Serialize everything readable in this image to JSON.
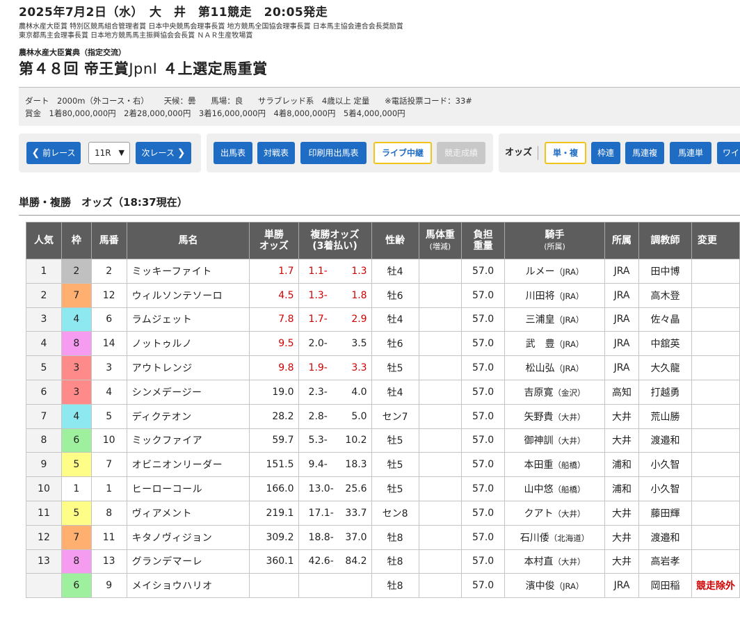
{
  "header": {
    "date_line": "2025年7月2日（水）　大　井　第11競走　20:05発走",
    "awards_line1": "農林水産大臣賞 特別区競馬組合管理者賞 日本中央競馬会理事長賞 地方競馬全国協会理事長賞 日本馬主協会連合会長奨励賞",
    "awards_line2": "東京都馬主会理事長賞 日本地方競馬馬主振興協会会長賞 ＮＡＲ生産牧場賞",
    "subtitle": "農林水産大臣賞典（指定交流）",
    "race_title_main": "第４８回 帝王賞",
    "race_title_grade": "JpnⅠ",
    "race_title_tail": "４上選定馬重賞"
  },
  "conditions": {
    "course": "ダート　2000m（外コース・右）",
    "weather": "天候：曇",
    "track": "馬場：良",
    "class": "サラブレッド系　4歳以上 定量",
    "phone_code": "※電話投票コード：33#",
    "prize": "賞金　1着80,000,000円　2着28,000,000円　3着16,000,000円　4着8,000,000円　5着4,000,000円"
  },
  "nav": {
    "prev_race": "前レース",
    "race_select_value": "11R",
    "next_race": "次レース",
    "entries": "出馬表",
    "matchup": "対戦表",
    "print_entries": "印刷用出馬表",
    "live": "ライブ中継",
    "results": "競走成績",
    "odds_label": "オッズ",
    "tansho_fukusho": "単・複",
    "wakuren": "枠連",
    "umaren_fuku": "馬連複",
    "umaren_tan": "馬連単",
    "wide": "ワイド"
  },
  "section_title": "単勝・複勝　オッズ（18:37現在）",
  "table": {
    "headers": {
      "ninki": "人気",
      "waku": "枠",
      "umaban": "馬番",
      "name": "馬名",
      "tansho_1": "単勝",
      "tansho_2": "オッズ",
      "fukusho_1": "複勝オッズ",
      "fukusho_2": "(3着払い)",
      "sexage": "性齢",
      "weight_1": "馬体重",
      "weight_2": "(増減)",
      "futan_1": "負担",
      "futan_2": "重量",
      "jockey_1": "騎手",
      "jockey_2": "(所属)",
      "shozoku": "所属",
      "trainer": "調教師",
      "change": "変更"
    },
    "waku_colors": {
      "1": "#ffffff",
      "2": "#c0c0c0",
      "3": "#ff8a8a",
      "4": "#8ee8f0",
      "5": "#fdfd88",
      "6": "#9ef09e",
      "7": "#ffb070",
      "8": "#f59cf0"
    },
    "rows": [
      {
        "ninki": "1",
        "waku": "2",
        "umaban": "2",
        "name": "ミッキーファイト",
        "tansho": "1.7",
        "fuku_lo": "1.1-",
        "fuku_hi": "1.3",
        "red": true,
        "sexage": "牡4",
        "weight": "",
        "futan": "57.0",
        "jockey": "ルメー",
        "jaff": "（JRA）",
        "shozoku": "JRA",
        "trainer": "田中博",
        "change": ""
      },
      {
        "ninki": "2",
        "waku": "7",
        "umaban": "12",
        "name": "ウィルソンテソーロ",
        "tansho": "4.5",
        "fuku_lo": "1.3-",
        "fuku_hi": "1.8",
        "red": true,
        "sexage": "牡6",
        "weight": "",
        "futan": "57.0",
        "jockey": "川田将",
        "jaff": "（JRA）",
        "shozoku": "JRA",
        "trainer": "高木登",
        "change": ""
      },
      {
        "ninki": "3",
        "waku": "4",
        "umaban": "6",
        "name": "ラムジェット",
        "tansho": "7.8",
        "fuku_lo": "1.7-",
        "fuku_hi": "2.9",
        "red": true,
        "sexage": "牡4",
        "weight": "",
        "futan": "57.0",
        "jockey": "三浦皇",
        "jaff": "（JRA）",
        "shozoku": "JRA",
        "trainer": "佐々晶",
        "change": ""
      },
      {
        "ninki": "4",
        "waku": "8",
        "umaban": "14",
        "name": "ノットゥルノ",
        "tansho": "9.5",
        "fuku_lo": "2.0-",
        "fuku_hi": "3.5",
        "red": "tansho",
        "sexage": "牡6",
        "weight": "",
        "futan": "57.0",
        "jockey": "武　豊",
        "jaff": "（JRA）",
        "shozoku": "JRA",
        "trainer": "中舘英",
        "change": ""
      },
      {
        "ninki": "5",
        "waku": "3",
        "umaban": "3",
        "name": "アウトレンジ",
        "tansho": "9.8",
        "fuku_lo": "1.9-",
        "fuku_hi": "3.3",
        "red": true,
        "sexage": "牡5",
        "weight": "",
        "futan": "57.0",
        "jockey": "松山弘",
        "jaff": "（JRA）",
        "shozoku": "JRA",
        "trainer": "大久龍",
        "change": ""
      },
      {
        "ninki": "6",
        "waku": "3",
        "umaban": "4",
        "name": "シンメデージー",
        "tansho": "19.0",
        "fuku_lo": "2.3-",
        "fuku_hi": "4.0",
        "red": false,
        "sexage": "牡4",
        "weight": "",
        "futan": "57.0",
        "jockey": "吉原寛",
        "jaff": "（金沢）",
        "shozoku": "高知",
        "trainer": "打越勇",
        "change": ""
      },
      {
        "ninki": "7",
        "waku": "4",
        "umaban": "5",
        "name": "ディクテオン",
        "tansho": "28.2",
        "fuku_lo": "2.8-",
        "fuku_hi": "5.0",
        "red": false,
        "sexage": "セン7",
        "weight": "",
        "futan": "57.0",
        "jockey": "矢野貴",
        "jaff": "（大井）",
        "shozoku": "大井",
        "trainer": "荒山勝",
        "change": ""
      },
      {
        "ninki": "8",
        "waku": "6",
        "umaban": "10",
        "name": "ミックファイア",
        "tansho": "59.7",
        "fuku_lo": "5.3-",
        "fuku_hi": "10.2",
        "red": false,
        "sexage": "牡5",
        "weight": "",
        "futan": "57.0",
        "jockey": "御神訓",
        "jaff": "（大井）",
        "shozoku": "大井",
        "trainer": "渡邉和",
        "change": ""
      },
      {
        "ninki": "9",
        "waku": "5",
        "umaban": "7",
        "name": "オビニオンリーダー",
        "tansho": "151.5",
        "fuku_lo": "9.4-",
        "fuku_hi": "18.3",
        "red": false,
        "sexage": "牡5",
        "weight": "",
        "futan": "57.0",
        "jockey": "本田重",
        "jaff": "（船橋）",
        "shozoku": "浦和",
        "trainer": "小久智",
        "change": ""
      },
      {
        "ninki": "10",
        "waku": "1",
        "umaban": "1",
        "name": "ヒーローコール",
        "tansho": "166.0",
        "fuku_lo": "13.0-",
        "fuku_hi": "25.6",
        "red": false,
        "sexage": "牡5",
        "weight": "",
        "futan": "57.0",
        "jockey": "山中悠",
        "jaff": "（船橋）",
        "shozoku": "浦和",
        "trainer": "小久智",
        "change": ""
      },
      {
        "ninki": "11",
        "waku": "5",
        "umaban": "8",
        "name": "ヴィアメント",
        "tansho": "219.1",
        "fuku_lo": "17.1-",
        "fuku_hi": "33.7",
        "red": false,
        "sexage": "セン8",
        "weight": "",
        "futan": "57.0",
        "jockey": "クアト",
        "jaff": "（大井）",
        "shozoku": "大井",
        "trainer": "藤田輝",
        "change": ""
      },
      {
        "ninki": "12",
        "waku": "7",
        "umaban": "11",
        "name": "キタノヴィジョン",
        "tansho": "309.2",
        "fuku_lo": "18.8-",
        "fuku_hi": "37.0",
        "red": false,
        "sexage": "牡8",
        "weight": "",
        "futan": "57.0",
        "jockey": "石川倭",
        "jaff": "（北海道）",
        "shozoku": "大井",
        "trainer": "渡邉和",
        "change": ""
      },
      {
        "ninki": "13",
        "waku": "8",
        "umaban": "13",
        "name": "グランデマーレ",
        "tansho": "360.1",
        "fuku_lo": "42.6-",
        "fuku_hi": "84.2",
        "red": false,
        "sexage": "牡8",
        "weight": "",
        "futan": "57.0",
        "jockey": "本村直",
        "jaff": "（大井）",
        "shozoku": "大井",
        "trainer": "高岩孝",
        "change": ""
      },
      {
        "ninki": "",
        "waku": "6",
        "umaban": "9",
        "name": "メイショウハリオ",
        "tansho": "",
        "fuku_lo": "",
        "fuku_hi": "",
        "red": false,
        "sexage": "牡8",
        "weight": "",
        "futan": "57.0",
        "jockey": "濱中俊",
        "jaff": "（JRA）",
        "shozoku": "JRA",
        "trainer": "岡田稲",
        "change": "競走除外"
      }
    ]
  }
}
